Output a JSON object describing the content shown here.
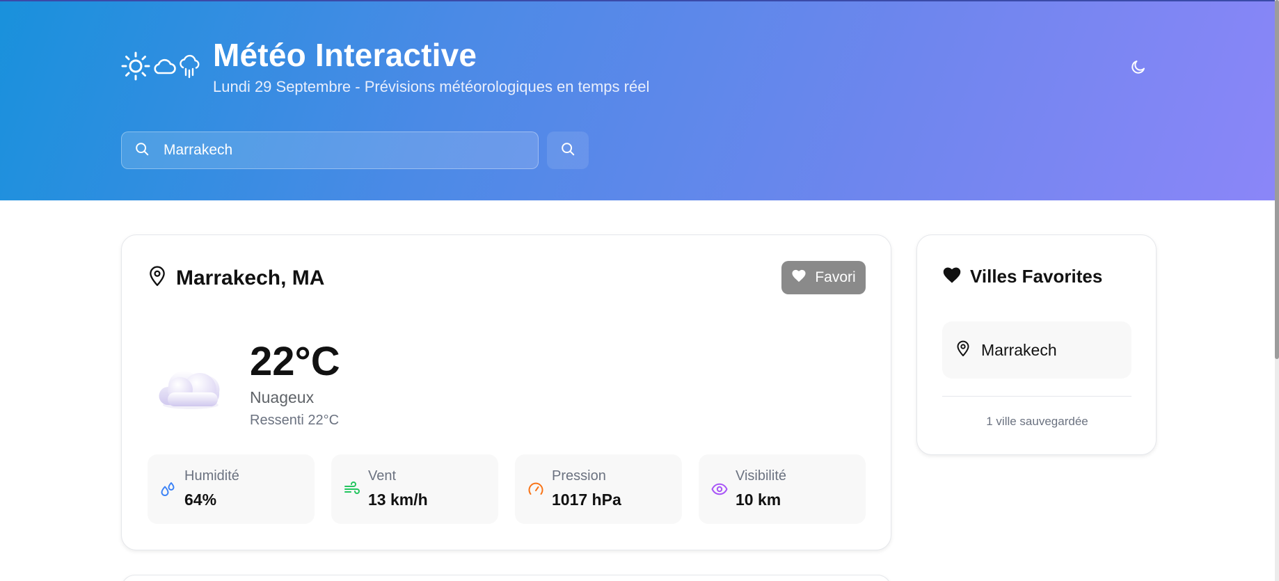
{
  "header": {
    "title": "Météo Interactive",
    "subtitle": "Lundi 29 Septembre - Prévisions météorologiques en temps réel",
    "logo_icons": [
      "sun-icon",
      "cloud-icon",
      "rain-cloud-icon"
    ],
    "theme_icon": "moon-icon"
  },
  "search": {
    "value": "Marrakech",
    "placeholder": "",
    "icon": "search-icon",
    "button_icon": "search-icon"
  },
  "current": {
    "city": "Marrakech, MA",
    "favorite_label": "Favori",
    "temperature": "22°C",
    "condition": "Nuageux",
    "feels_like": "Ressenti 22°C",
    "icon": "cloud-icon",
    "stats": [
      {
        "label": "Humidité",
        "value": "64%",
        "icon": "droplets-icon",
        "color": "#3b82f6"
      },
      {
        "label": "Vent",
        "value": "13 km/h",
        "icon": "wind-icon",
        "color": "#22c55e"
      },
      {
        "label": "Pression",
        "value": "1017 hPa",
        "icon": "gauge-icon",
        "color": "#f97316"
      },
      {
        "label": "Visibilité",
        "value": "10 km",
        "icon": "eye-icon",
        "color": "#a855f7"
      }
    ]
  },
  "favorites": {
    "title": "Villes Favorites",
    "items": [
      {
        "label": "Marrakech"
      }
    ],
    "count_text": "1 ville sauvegardée"
  },
  "colors": {
    "header_gradient_start": "#1991dc",
    "header_gradient_end": "#8b86f8",
    "favorite_button": "#8a8a8a"
  }
}
